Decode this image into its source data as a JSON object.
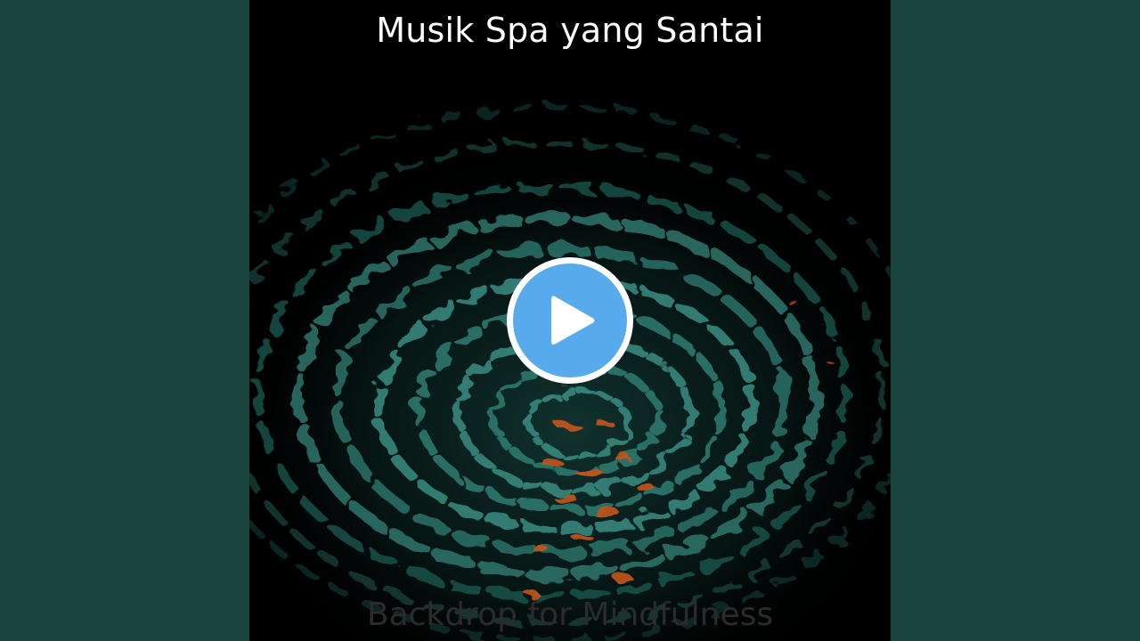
{
  "album": {
    "title": "Musik Spa yang Santai",
    "subtitle": "Backdrop for Mindfulness"
  },
  "player": {
    "play_icon": "play-icon",
    "play_button_color": "#57abed",
    "play_button_ring_color": "#ffffff"
  },
  "colors": {
    "side_background": "#1a453f",
    "artwork_background": "#000000",
    "water_highlight": "#2e7c72",
    "reflection_orange": "#c4561c"
  }
}
